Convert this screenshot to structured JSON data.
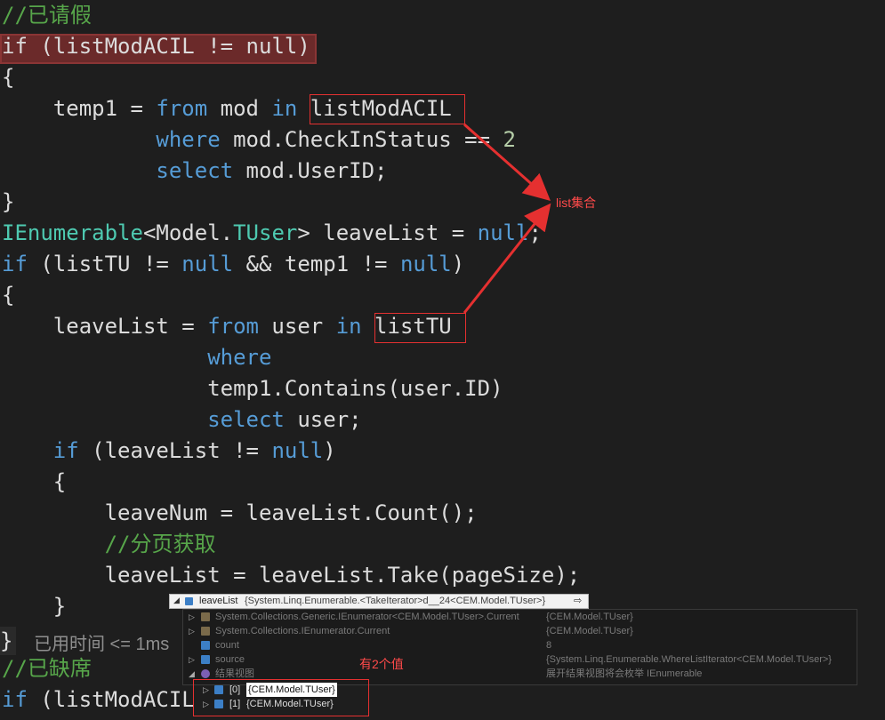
{
  "code_lines": [
    [
      {
        "t": "//已请假",
        "c": "cm"
      }
    ],
    [
      {
        "t": "if",
        "c": "pl"
      },
      {
        "t": " (listModACIL != null)",
        "c": "pl"
      }
    ],
    [
      {
        "t": "{",
        "c": "pl"
      }
    ],
    [
      {
        "t": "    temp1 = ",
        "c": "pl"
      },
      {
        "t": "from",
        "c": "kw"
      },
      {
        "t": " mod ",
        "c": "pl"
      },
      {
        "t": "in",
        "c": "kw"
      },
      {
        "t": " listModACIL",
        "c": "pl"
      }
    ],
    [
      {
        "t": "            ",
        "c": "pl"
      },
      {
        "t": "where",
        "c": "kw"
      },
      {
        "t": " mod.CheckInStatus == ",
        "c": "pl"
      },
      {
        "t": "2",
        "c": "num"
      }
    ],
    [
      {
        "t": "            ",
        "c": "pl"
      },
      {
        "t": "select",
        "c": "kw"
      },
      {
        "t": " mod.UserID;",
        "c": "pl"
      }
    ],
    [
      {
        "t": "}",
        "c": "pl"
      }
    ],
    [
      {
        "t": "IEnumerable",
        "c": "ty"
      },
      {
        "t": "<Model.",
        "c": "pl"
      },
      {
        "t": "TUser",
        "c": "ty"
      },
      {
        "t": "> leaveList = ",
        "c": "pl"
      },
      {
        "t": "null",
        "c": "kw"
      },
      {
        "t": ";",
        "c": "pl"
      }
    ],
    [
      {
        "t": "if",
        "c": "kw"
      },
      {
        "t": " (listTU != ",
        "c": "pl"
      },
      {
        "t": "null",
        "c": "kw"
      },
      {
        "t": " && temp1 != ",
        "c": "pl"
      },
      {
        "t": "null",
        "c": "kw"
      },
      {
        "t": ")",
        "c": "pl"
      }
    ],
    [
      {
        "t": "{",
        "c": "pl"
      }
    ],
    [
      {
        "t": "    leaveList = ",
        "c": "pl"
      },
      {
        "t": "from",
        "c": "kw"
      },
      {
        "t": " user ",
        "c": "pl"
      },
      {
        "t": "in",
        "c": "kw"
      },
      {
        "t": " listTU",
        "c": "pl"
      }
    ],
    [
      {
        "t": "                ",
        "c": "pl"
      },
      {
        "t": "where",
        "c": "kw"
      }
    ],
    [
      {
        "t": "                temp1.Contains(user.ID)",
        "c": "pl"
      }
    ],
    [
      {
        "t": "                ",
        "c": "pl"
      },
      {
        "t": "select",
        "c": "kw"
      },
      {
        "t": " user;",
        "c": "pl"
      }
    ],
    [
      {
        "t": "    ",
        "c": "pl"
      },
      {
        "t": "if",
        "c": "kw"
      },
      {
        "t": " (leaveList != ",
        "c": "pl"
      },
      {
        "t": "null",
        "c": "kw"
      },
      {
        "t": ")",
        "c": "pl"
      }
    ],
    [
      {
        "t": "    {",
        "c": "pl"
      }
    ],
    [
      {
        "t": "        leaveNum = leaveList.Count();",
        "c": "pl"
      }
    ],
    [
      {
        "t": "        ",
        "c": "pl"
      },
      {
        "t": "//分页获取",
        "c": "cm"
      }
    ],
    [
      {
        "t": "        leaveList = leaveList.Take(pageSize);",
        "c": "pl"
      }
    ],
    [
      {
        "t": "    }",
        "c": "pl"
      }
    ],
    [
      {
        "t": "}",
        "c": "pl"
      }
    ],
    [
      {
        "t": "//已缺席",
        "c": "cm"
      }
    ],
    [
      {
        "t": "if",
        "c": "kw"
      },
      {
        "t": " (listModACIL",
        "c": "pl"
      }
    ]
  ],
  "annotation": {
    "list_label": "list集合",
    "count_label": "有2个值"
  },
  "perf_tip": "已用时间 <= 1ms",
  "datatip": {
    "name": "leaveList",
    "value": "{System.Linq.Enumerable.<TakeIterator>d__24<CEM.Model.TUser>}",
    "pin_icon": "pin-icon",
    "rows": [
      {
        "name": "System.Collections.Generic.IEnumerator<CEM.Model.TUser>.Current",
        "value": "{CEM.Model.TUser}",
        "icon": "lock-property-icon"
      },
      {
        "name": "System.Collections.IEnumerator.Current",
        "value": "{CEM.Model.TUser}",
        "icon": "lock-property-icon"
      },
      {
        "name": "count",
        "value": "8",
        "icon": "field-icon"
      },
      {
        "name": "source",
        "value": "{System.Linq.Enumerable.WhereListIterator<CEM.Model.TUser>}",
        "icon": "field-icon"
      },
      {
        "name": "结果视图",
        "value": "展开结果视图将会枚举 IEnumerable",
        "icon": "results-view-icon"
      }
    ],
    "children": [
      {
        "index": "[0]",
        "value": "{CEM.Model.TUser}"
      },
      {
        "index": "[1]",
        "value": "{CEM.Model.TUser}"
      }
    ]
  },
  "colors": {
    "background": "#1e1e1e",
    "keyword": "#569cd6",
    "comment": "#57a64a",
    "type": "#4ec9b0",
    "number": "#b5cea8",
    "breakpoint": "#6b2a2a",
    "annotation": "#ff4a4a"
  }
}
